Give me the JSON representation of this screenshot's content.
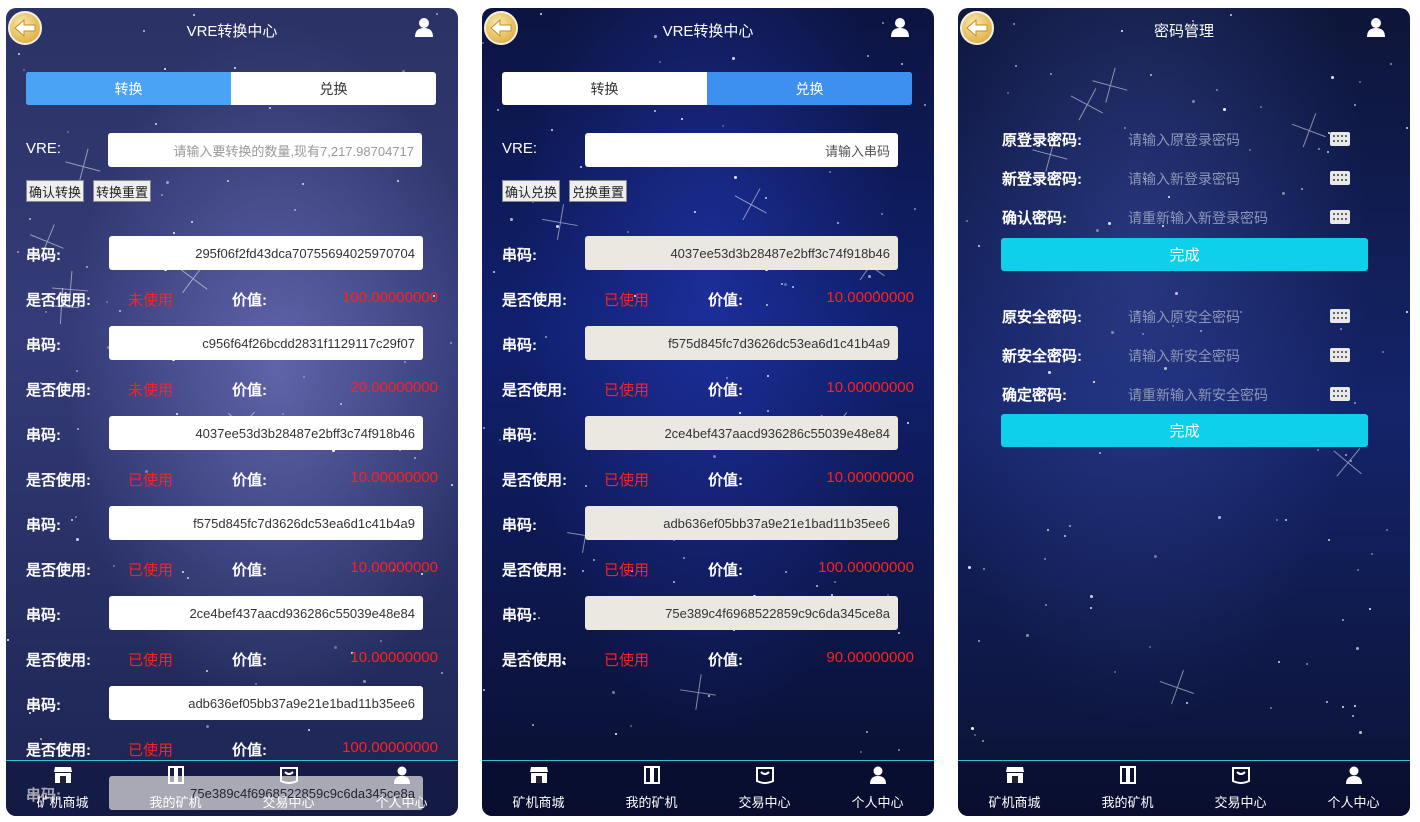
{
  "screens": {
    "convert": {
      "title": "VRE转换中心",
      "tabs": [
        "转换",
        "兑换"
      ],
      "active_tab": 0,
      "vre_label": "VRE:",
      "vre_placeholder": "请输入要转换的数量,现有7,217.98704717",
      "confirm_btn": "确认转换",
      "reset_btn": "转换重置",
      "code_label": "串码:",
      "used_label": "是否使用:",
      "value_label": "价值:",
      "records": [
        {
          "code": "295f06f2fd43dca70755694025970704",
          "used": "未使用",
          "value": "100.00000000"
        },
        {
          "code": "c956f64f26bcdd2831f1129117c29f07",
          "used": "未使用",
          "value": "20.00000000"
        },
        {
          "code": "4037ee53d3b28487e2bff3c74f918b46",
          "used": "已使用",
          "value": "10.00000000"
        },
        {
          "code": "f575d845fc7d3626dc53ea6d1c41b4a9",
          "used": "已使用",
          "value": "10.00000000"
        },
        {
          "code": "2ce4bef437aacd936286c55039e48e84",
          "used": "已使用",
          "value": "10.00000000"
        },
        {
          "code": "adb636ef05bb37a9e21e1bad11b35ee6",
          "used": "已使用",
          "value": "100.00000000"
        },
        {
          "code": "75e389c4f6968522859c9c6da345ce8a"
        }
      ]
    },
    "redeem": {
      "title": "VRE转换中心",
      "tabs": [
        "转换",
        "兑换"
      ],
      "active_tab": 1,
      "vre_label": "VRE:",
      "vre_placeholder": "请输入串码",
      "confirm_btn": "确认兑换",
      "reset_btn": "兑换重置",
      "code_label": "串码:",
      "used_label": "是否使用:",
      "value_label": "价值:",
      "records": [
        {
          "code": "4037ee53d3b28487e2bff3c74f918b46",
          "used": "已使用",
          "value": "10.00000000"
        },
        {
          "code": "f575d845fc7d3626dc53ea6d1c41b4a9",
          "used": "已使用",
          "value": "10.00000000"
        },
        {
          "code": "2ce4bef437aacd936286c55039e48e84",
          "used": "已使用",
          "value": "10.00000000"
        },
        {
          "code": "adb636ef05bb37a9e21e1bad11b35ee6",
          "used": "已使用",
          "value": "100.00000000"
        },
        {
          "code": "75e389c4f6968522859c9c6da345ce8a",
          "used": "已使用",
          "value": "90.00000000"
        }
      ]
    },
    "password": {
      "title": "密码管理",
      "login_group": [
        {
          "label": "原登录密码:",
          "placeholder": "请输入原登录密码"
        },
        {
          "label": "新登录密码:",
          "placeholder": "请输入新登录密码"
        },
        {
          "label": "确认密码:",
          "placeholder": "请重新输入新登录密码"
        }
      ],
      "security_group": [
        {
          "label": "原安全密码:",
          "placeholder": "请输入原安全密码"
        },
        {
          "label": "新安全密码:",
          "placeholder": "请输入新安全密码"
        },
        {
          "label": "确定密码:",
          "placeholder": "请重新输入新安全密码"
        }
      ],
      "done_btn": "完成"
    }
  },
  "nav": [
    {
      "label": "矿机商城",
      "icon": "shop-icon"
    },
    {
      "label": "我的矿机",
      "icon": "miner-icon"
    },
    {
      "label": "交易中心",
      "icon": "trade-icon"
    },
    {
      "label": "个人中心",
      "icon": "user-icon"
    }
  ],
  "colors": {
    "tab_active": "#4ba3f5",
    "used_red": "#ff2020",
    "done_button": "#0fd0ea",
    "nav_border": "#2ec4d6"
  }
}
